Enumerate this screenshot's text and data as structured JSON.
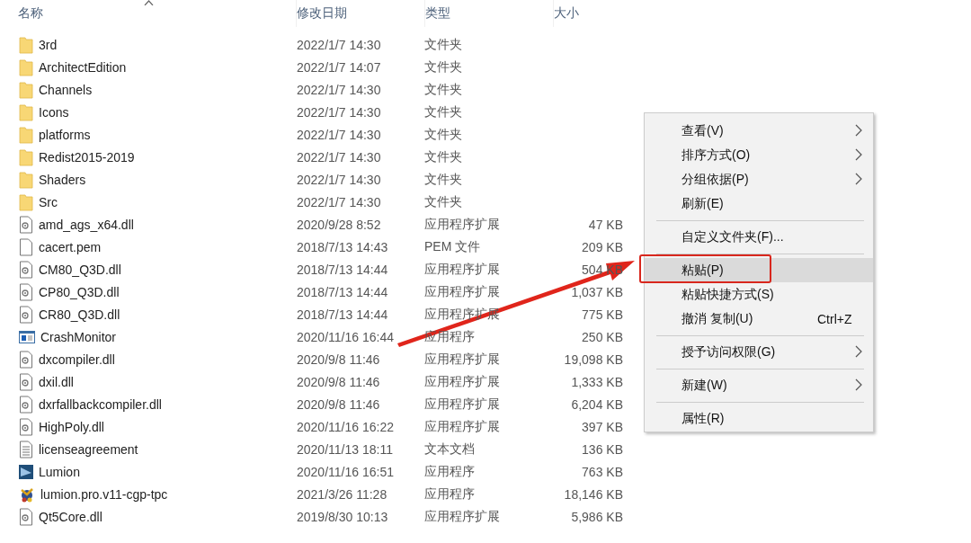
{
  "columns": [
    {
      "label": "名称",
      "sorted": true
    },
    {
      "label": "修改日期",
      "sorted": false
    },
    {
      "label": "类型",
      "sorted": false
    },
    {
      "label": "大小",
      "sorted": false
    }
  ],
  "files": [
    {
      "kind": "folder",
      "name": "3rd",
      "date": "2022/1/7 14:30",
      "type": "文件夹"
    },
    {
      "kind": "folder",
      "name": "ArchitectEdition",
      "date": "2022/1/7 14:07",
      "type": "文件夹"
    },
    {
      "kind": "folder",
      "name": "Channels",
      "date": "2022/1/7 14:30",
      "type": "文件夹"
    },
    {
      "kind": "folder",
      "name": "Icons",
      "date": "2022/1/7 14:30",
      "type": "文件夹"
    },
    {
      "kind": "folder",
      "name": "platforms",
      "date": "2022/1/7 14:30",
      "type": "文件夹"
    },
    {
      "kind": "folder",
      "name": "Redist2015-2019",
      "date": "2022/1/7 14:30",
      "type": "文件夹"
    },
    {
      "kind": "folder",
      "name": "Shaders",
      "date": "2022/1/7 14:30",
      "type": "文件夹"
    },
    {
      "kind": "folder",
      "name": "Src",
      "date": "2022/1/7 14:30",
      "type": "文件夹"
    },
    {
      "kind": "dll",
      "name": "amd_ags_x64.dll",
      "date": "2020/9/28 8:52",
      "type": "应用程序扩展",
      "size": "47 KB"
    },
    {
      "kind": "file",
      "name": "cacert.pem",
      "date": "2018/7/13 14:43",
      "type": "PEM 文件",
      "size": "209 KB"
    },
    {
      "kind": "dll",
      "name": "CM80_Q3D.dll",
      "date": "2018/7/13 14:44",
      "type": "应用程序扩展",
      "size": "504 KB"
    },
    {
      "kind": "dll",
      "name": "CP80_Q3D.dll",
      "date": "2018/7/13 14:44",
      "type": "应用程序扩展",
      "size": "1,037 KB"
    },
    {
      "kind": "dll",
      "name": "CR80_Q3D.dll",
      "date": "2018/7/13 14:44",
      "type": "应用程序扩展",
      "size": "775 KB"
    },
    {
      "kind": "app",
      "name": "CrashMonitor",
      "date": "2020/11/16 16:44",
      "type": "应用程序",
      "size": "250 KB"
    },
    {
      "kind": "dll",
      "name": "dxcompiler.dll",
      "date": "2020/9/8 11:46",
      "type": "应用程序扩展",
      "size": "19,098 KB"
    },
    {
      "kind": "dll",
      "name": "dxil.dll",
      "date": "2020/9/8 11:46",
      "type": "应用程序扩展",
      "size": "1,333 KB"
    },
    {
      "kind": "dll",
      "name": "dxrfallbackcompiler.dll",
      "date": "2020/9/8 11:46",
      "type": "应用程序扩展",
      "size": "6,204 KB"
    },
    {
      "kind": "dll",
      "name": "HighPoly.dll",
      "date": "2020/11/16 16:22",
      "type": "应用程序扩展",
      "size": "397 KB"
    },
    {
      "kind": "text",
      "name": "licenseagreement",
      "date": "2020/11/13 18:11",
      "type": "文本文档",
      "size": "136 KB"
    },
    {
      "kind": "lumion",
      "name": "Lumion",
      "date": "2020/11/16 16:51",
      "type": "应用程序",
      "size": "763 KB"
    },
    {
      "kind": "exe",
      "name": "lumion.pro.v11-cgp-tpc",
      "date": "2021/3/26 11:28",
      "type": "应用程序",
      "size": "18,146 KB"
    },
    {
      "kind": "dll",
      "name": "Qt5Core.dll",
      "date": "2019/8/30 10:13",
      "type": "应用程序扩展",
      "size": "5,986 KB"
    }
  ],
  "context_menu": [
    {
      "kind": "item",
      "label": "查看(V)",
      "submenu": true,
      "selected": false
    },
    {
      "kind": "item",
      "label": "排序方式(O)",
      "submenu": true,
      "selected": false
    },
    {
      "kind": "item",
      "label": "分组依据(P)",
      "submenu": true,
      "selected": false
    },
    {
      "kind": "item",
      "label": "刷新(E)",
      "submenu": false,
      "selected": false
    },
    {
      "kind": "separator"
    },
    {
      "kind": "item",
      "label": "自定义文件夹(F)...",
      "submenu": false,
      "selected": false
    },
    {
      "kind": "separator"
    },
    {
      "kind": "item",
      "label": "粘贴(P)",
      "submenu": false,
      "selected": true,
      "marked": true
    },
    {
      "kind": "item",
      "label": "粘贴快捷方式(S)",
      "submenu": false,
      "selected": false
    },
    {
      "kind": "item",
      "label": "撤消 复制(U)",
      "shortcut": "Ctrl+Z",
      "submenu": false,
      "selected": false
    },
    {
      "kind": "separator"
    },
    {
      "kind": "item",
      "label": "授予访问权限(G)",
      "submenu": true,
      "selected": false
    },
    {
      "kind": "separator"
    },
    {
      "kind": "item",
      "label": "新建(W)",
      "submenu": true,
      "selected": false
    },
    {
      "kind": "separator"
    },
    {
      "kind": "item",
      "label": "属性(R)",
      "submenu": false,
      "selected": false
    }
  ]
}
